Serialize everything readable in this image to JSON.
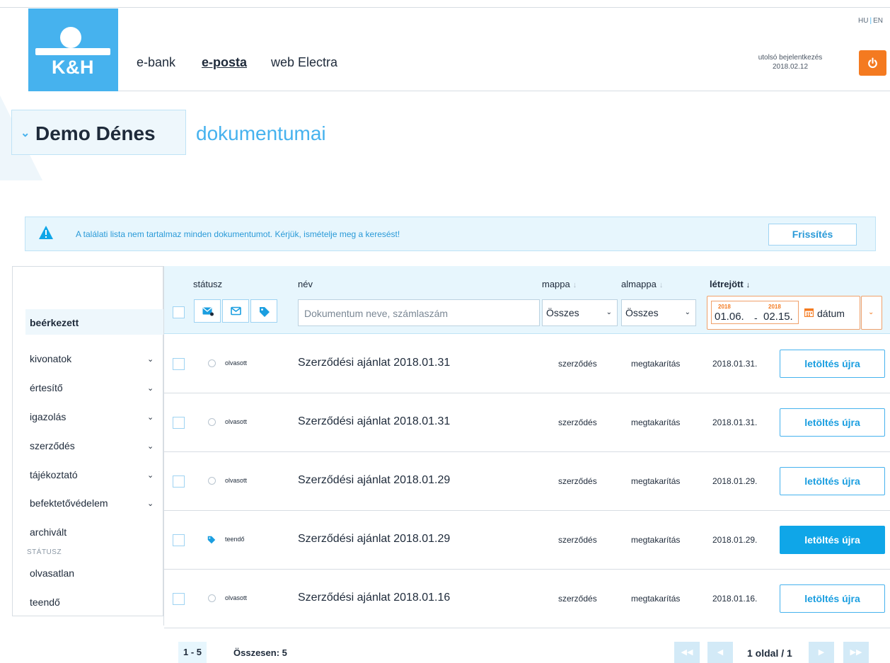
{
  "header": {
    "logo_text": "K&H",
    "nav": [
      "e-bank",
      "e-posta",
      "web Electra"
    ],
    "lang_hu": "HU",
    "lang_en": "EN",
    "last_login_label": "utolsó bejelentkezés",
    "last_login_date": "2018.02.12"
  },
  "title": {
    "name": "Demo Dénes",
    "suffix": "dokumentumai"
  },
  "alert": {
    "text": "A találati lista nem tartalmaz minden dokumentumot. Kérjük, ismételje meg a keresést!",
    "button": "Frissítés"
  },
  "sidebar": {
    "active": "beérkezett",
    "items": [
      "kivonatok",
      "értesítő",
      "igazolás",
      "szerződés",
      "tájékoztató",
      "befektetővédelem",
      "archivált"
    ],
    "status_label": "STÁTUSZ",
    "status_items": [
      "olvasatlan",
      "teendő"
    ]
  },
  "table": {
    "headers": {
      "status": "státusz",
      "name": "név",
      "folder": "mappa",
      "subfolder": "almappa",
      "created": "létrejött"
    },
    "search_placeholder": "Dokumentum neve, számlaszám",
    "folder_value": "Összes",
    "subfolder_value": "Összes",
    "date_from_year": "2018",
    "date_from": "01.06.",
    "date_sep": "-",
    "date_to_year": "2018",
    "date_to": "02.15.",
    "date_button": "dátum",
    "rows": [
      {
        "status": "olvasott",
        "name": "Szerződési ajánlat 2018.01.31",
        "folder": "szerződés",
        "subfolder": "megtakarítás",
        "date": "2018.01.31.",
        "action": "letöltés újra"
      },
      {
        "status": "olvasott",
        "name": "Szerződési ajánlat 2018.01.31",
        "folder": "szerződés",
        "subfolder": "megtakarítás",
        "date": "2018.01.31.",
        "action": "letöltés újra"
      },
      {
        "status": "olvasott",
        "name": "Szerződési ajánlat 2018.01.29",
        "folder": "szerződés",
        "subfolder": "megtakarítás",
        "date": "2018.01.29.",
        "action": "letöltés újra"
      },
      {
        "status": "teendő",
        "name": "Szerződési ajánlat 2018.01.29",
        "folder": "szerződés",
        "subfolder": "megtakarítás",
        "date": "2018.01.29.",
        "action": "letöltés újra"
      },
      {
        "status": "olvasott",
        "name": "Szerződési ajánlat 2018.01.16",
        "folder": "szerződés",
        "subfolder": "megtakarítás",
        "date": "2018.01.16.",
        "action": "letöltés újra"
      }
    ]
  },
  "footer": {
    "range": "1 - 5",
    "total": "Összesen: 5",
    "page_info": "1 oldal / 1"
  },
  "colors": {
    "brand_blue": "#46b2ee",
    "accent_orange": "#f47a20",
    "button_primary": "#0fa6e8"
  }
}
